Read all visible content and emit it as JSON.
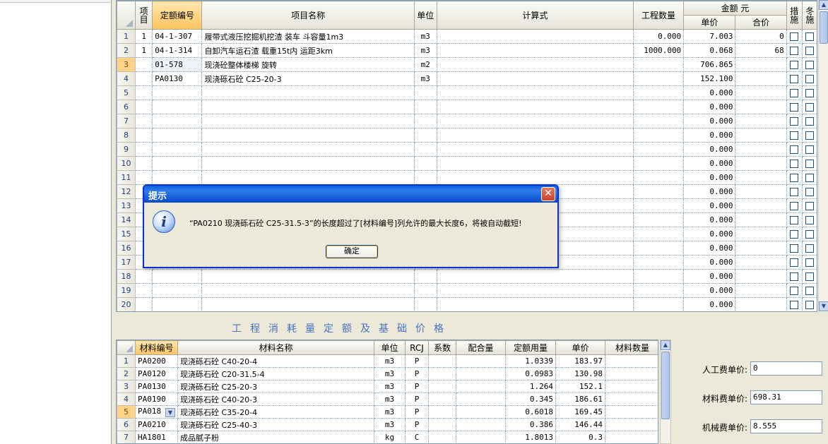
{
  "top_table": {
    "headers": {
      "item": "项目",
      "code": "定额编号",
      "name": "项目名称",
      "unit": "单位",
      "formula": "计算式",
      "qty": "工程数量",
      "amount_group": "金额 元",
      "unit_price": "单价",
      "total": "合价",
      "measure": "措施",
      "winter": "冬施"
    },
    "rows": [
      {
        "n": "1",
        "item": "1",
        "code": "04-1-307",
        "name": "履带式液压挖掘机挖渣 装车 斗容量1m3",
        "unit": "m3",
        "formula": "",
        "qty": "0.000",
        "price": "7.003",
        "total": "0"
      },
      {
        "n": "2",
        "item": "1",
        "code": "04-1-314",
        "name": "自卸汽车运石渣 载重15t内 运距3km",
        "unit": "m3",
        "formula": "",
        "qty": "1000.000",
        "price": "0.068",
        "total": "68"
      },
      {
        "n": "3",
        "item": "",
        "code": "01-578",
        "name": "现浇砼整体楼梯 旋转",
        "unit": "m2",
        "formula": "",
        "qty": "",
        "price": "706.865",
        "total": ""
      },
      {
        "n": "4",
        "item": "",
        "code": "PA0130",
        "name": "现浇砾石砼 C25-20-3",
        "unit": "m3",
        "formula": "",
        "qty": "",
        "price": "152.100",
        "total": ""
      },
      {
        "n": "5",
        "item": "",
        "code": "",
        "name": "",
        "unit": "",
        "formula": "",
        "qty": "",
        "price": "0.000",
        "total": ""
      },
      {
        "n": "6",
        "item": "",
        "code": "",
        "name": "",
        "unit": "",
        "formula": "",
        "qty": "",
        "price": "0.000",
        "total": ""
      },
      {
        "n": "7",
        "item": "",
        "code": "",
        "name": "",
        "unit": "",
        "formula": "",
        "qty": "",
        "price": "0.000",
        "total": ""
      },
      {
        "n": "8",
        "item": "",
        "code": "",
        "name": "",
        "unit": "",
        "formula": "",
        "qty": "",
        "price": "0.000",
        "total": ""
      },
      {
        "n": "9",
        "item": "",
        "code": "",
        "name": "",
        "unit": "",
        "formula": "",
        "qty": "",
        "price": "0.000",
        "total": ""
      },
      {
        "n": "10",
        "item": "",
        "code": "",
        "name": "",
        "unit": "",
        "formula": "",
        "qty": "",
        "price": "0.000",
        "total": ""
      },
      {
        "n": "11",
        "item": "",
        "code": "",
        "name": "",
        "unit": "",
        "formula": "",
        "qty": "",
        "price": "0.000",
        "total": ""
      },
      {
        "n": "12",
        "item": "",
        "code": "",
        "name": "",
        "unit": "",
        "formula": "",
        "qty": "",
        "price": "0.000",
        "total": ""
      },
      {
        "n": "13",
        "item": "",
        "code": "",
        "name": "",
        "unit": "",
        "formula": "",
        "qty": "",
        "price": "0.000",
        "total": ""
      },
      {
        "n": "14",
        "item": "",
        "code": "",
        "name": "",
        "unit": "",
        "formula": "",
        "qty": "",
        "price": "0.000",
        "total": ""
      },
      {
        "n": "15",
        "item": "",
        "code": "",
        "name": "",
        "unit": "",
        "formula": "",
        "qty": "",
        "price": "0.000",
        "total": ""
      },
      {
        "n": "16",
        "item": "",
        "code": "",
        "name": "",
        "unit": "",
        "formula": "",
        "qty": "",
        "price": "0.000",
        "total": ""
      },
      {
        "n": "17",
        "item": "",
        "code": "",
        "name": "",
        "unit": "",
        "formula": "",
        "qty": "",
        "price": "0.000",
        "total": ""
      },
      {
        "n": "18",
        "item": "",
        "code": "",
        "name": "",
        "unit": "",
        "formula": "",
        "qty": "",
        "price": "0.000",
        "total": ""
      },
      {
        "n": "19",
        "item": "",
        "code": "",
        "name": "",
        "unit": "",
        "formula": "",
        "qty": "",
        "price": "0.000",
        "total": ""
      },
      {
        "n": "20",
        "item": "",
        "code": "",
        "name": "",
        "unit": "",
        "formula": "",
        "qty": "",
        "price": "0.000",
        "total": ""
      }
    ]
  },
  "section_title": "工程消耗量定额及基础价格",
  "bottom_table": {
    "headers": {
      "code": "材料编号",
      "name": "材料名称",
      "unit": "单位",
      "rcj": "RCJ",
      "coef": "系数",
      "mix": "配合量",
      "usage": "定额用量",
      "price": "单价",
      "count": "材料数量"
    },
    "rows": [
      {
        "n": "1",
        "code": "PA0200",
        "name": "现浇砾石砼 C40-20-4",
        "unit": "m3",
        "rcj": "P",
        "coef": "",
        "mix": "",
        "usage": "1.0339",
        "price": "183.97",
        "count": ""
      },
      {
        "n": "2",
        "code": "PA0120",
        "name": "现浇砾石砼 C20-31.5-4",
        "unit": "m3",
        "rcj": "P",
        "coef": "",
        "mix": "",
        "usage": "0.0983",
        "price": "130.98",
        "count": ""
      },
      {
        "n": "3",
        "code": "PA0130",
        "name": "现浇砾石砼 C25-20-3",
        "unit": "m3",
        "rcj": "P",
        "coef": "",
        "mix": "",
        "usage": "1.264",
        "price": "152.1",
        "count": ""
      },
      {
        "n": "4",
        "code": "PA0190",
        "name": "现浇砾石砼 C40-20-3",
        "unit": "m3",
        "rcj": "P",
        "coef": "",
        "mix": "",
        "usage": "0.345",
        "price": "186.61",
        "count": ""
      },
      {
        "n": "5",
        "code": "PA018",
        "name": "现浇砾石砼 C35-20-4",
        "unit": "m3",
        "rcj": "P",
        "coef": "",
        "mix": "",
        "usage": "0.6018",
        "price": "169.45",
        "count": ""
      },
      {
        "n": "6",
        "code": "PA0210",
        "name": "现浇砾石砼 C25-40-3",
        "unit": "m3",
        "rcj": "P",
        "coef": "",
        "mix": "",
        "usage": "0.386",
        "price": "146.44",
        "count": ""
      },
      {
        "n": "7",
        "code": "HA1801",
        "name": "成品腻子粉",
        "unit": "kg",
        "rcj": "C",
        "coef": "",
        "mix": "",
        "usage": "1.8013",
        "price": "0.3",
        "count": ""
      }
    ]
  },
  "fees": {
    "labor_label": "人工费单价:",
    "labor_value": "0",
    "material_label": "材料费单价:",
    "material_value": "698.31",
    "machine_label": "机械费单价:",
    "machine_value": "8.555"
  },
  "dialog": {
    "title": "提示",
    "message": "“PA0210 现浇砾石砼 C25-31.5-3”的长度超过了[材料编号]列允许的最大长度6，将被自动截短!",
    "ok_label": "确定",
    "close_glyph": "✕",
    "icon_glyph": "i"
  },
  "colors": {
    "dialog_title": "#0a5fdc",
    "selected_row": "#ffd28a",
    "section_title": "#4472c4"
  }
}
